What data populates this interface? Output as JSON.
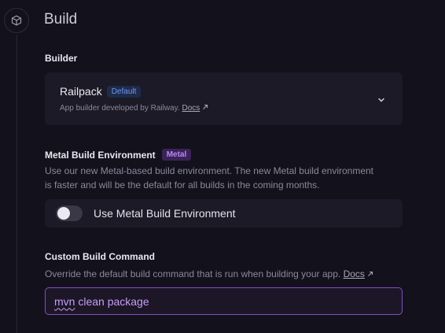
{
  "section": {
    "title": "Build",
    "icon": "cube-icon"
  },
  "builder": {
    "label": "Builder",
    "name": "Railpack",
    "badge": "Default",
    "description": "App builder developed by Railway.",
    "docs_link": "Docs",
    "chevron_icon": "chevron-down-icon",
    "external_icon": "external-link-icon"
  },
  "metal": {
    "label": "Metal Build Environment",
    "badge": "Metal",
    "description_line1": "Use our new Metal-based build environment. The new Metal build environment",
    "description_line2": "is faster and will be the default for all builds in the coming months.",
    "toggle_label": "Use Metal Build Environment",
    "toggle_on": false
  },
  "custom_build": {
    "label": "Custom Build Command",
    "description": "Override the default build command that is run when building your app.",
    "docs_link": "Docs",
    "external_icon": "external-link-icon",
    "value_first_word": "mvn",
    "value_rest": " clean package"
  },
  "colors": {
    "background": "#13111c",
    "card": "#1c1a26",
    "accent_purple": "#7f4fc5",
    "badge_blue": "#6f97f2",
    "badge_purple": "#b88af0"
  }
}
